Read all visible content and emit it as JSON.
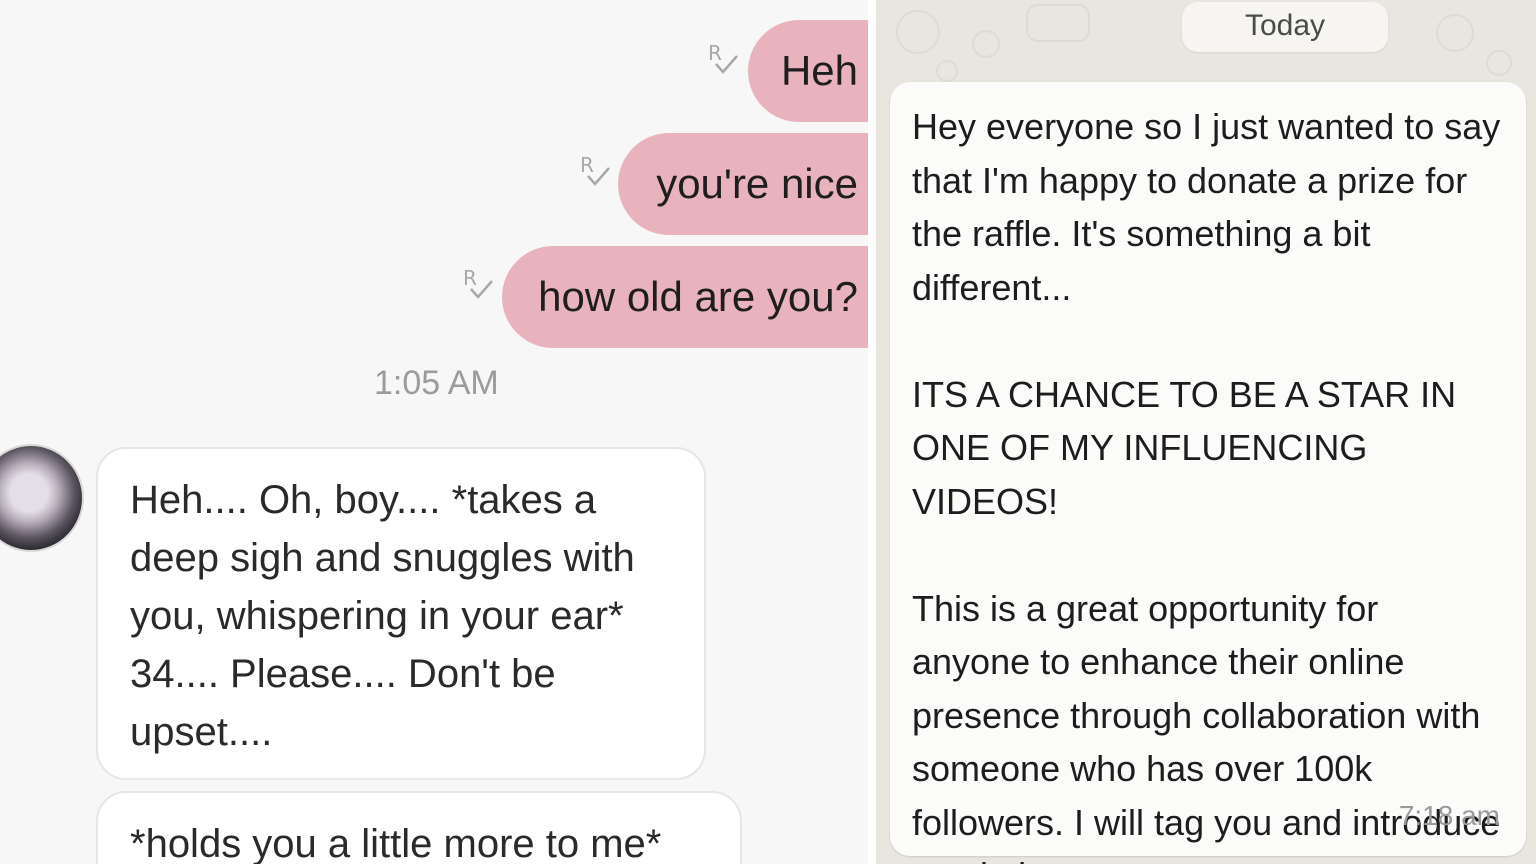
{
  "left_chat": {
    "outgoing": [
      {
        "text": "Heh",
        "receipt_icon": "read-receipt-icon"
      },
      {
        "text": "you're nice",
        "receipt_icon": "read-receipt-icon"
      },
      {
        "text": "how old are you?",
        "receipt_icon": "read-receipt-icon"
      }
    ],
    "receipt_glyph": "R",
    "timestamp": "1:05 AM",
    "incoming": [
      {
        "text": "Heh.... Oh, boy.... *takes a deep sigh and snuggles with you, whispering in your ear* 34.... Please.... Don't be upset...."
      },
      {
        "text": "*holds you a little more to me*"
      }
    ],
    "colors": {
      "outgoing_bubble": "#e9b3bd",
      "background": "#f7f7f7"
    }
  },
  "right_chat": {
    "date_chip": "Today",
    "message": {
      "para1": "Hey everyone so I just wanted to say that I'm happy to donate a prize for the raffle. It's something a bit different...",
      "para2": "ITS A CHANCE TO BE A STAR IN ONE OF MY INFLUENCING VIDEOS!",
      "para3": "This is a great opportunity for anyone to enhance their online presence through collaboration with someone who has over 100k followers. I will tag you and introduce you in it too.",
      "time": "7:18 am"
    },
    "colors": {
      "background": "#e9e6e0",
      "bubble": "#fbfbfa"
    }
  }
}
